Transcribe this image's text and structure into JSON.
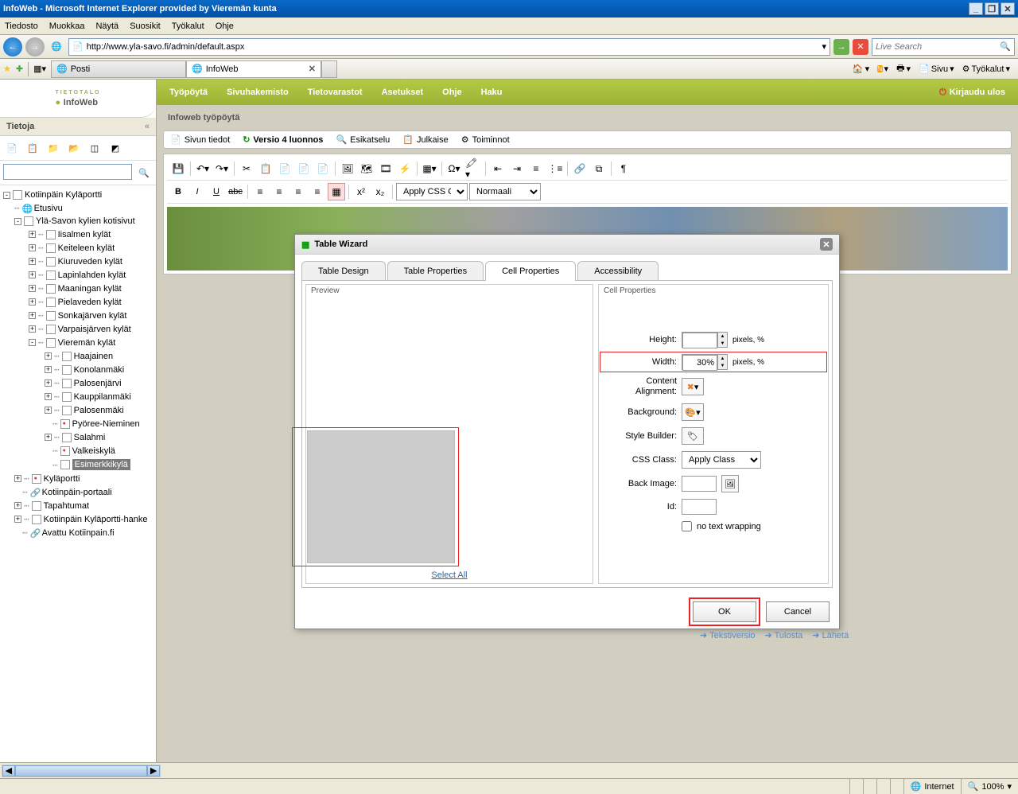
{
  "window": {
    "title": "InfoWeb - Microsoft Internet Explorer provided by Vieremän kunta"
  },
  "menu": {
    "tiedosto": "Tiedosto",
    "muokkaa": "Muokkaa",
    "nayta": "Näytä",
    "suosikit": "Suosikit",
    "tyokalut": "Työkalut",
    "ohje": "Ohje"
  },
  "address": {
    "url": "http://www.yla-savo.fi/admin/default.aspx",
    "search_placeholder": "Live Search"
  },
  "tabs": {
    "posti": "Posti",
    "infoweb": "InfoWeb"
  },
  "rightbar": {
    "sivu": "Sivu",
    "tyokalut": "Työkalut"
  },
  "logo": {
    "brand": "InfoWeb",
    "sub": "TIETOTALO"
  },
  "greenbar": {
    "tyopoyto": "Työpöytä",
    "sivuhakemisto": "Sivuhakemisto",
    "tietovarastot": "Tietovarastot",
    "asetukset": "Asetukset",
    "ohje": "Ohje",
    "haku": "Haku",
    "logout": "Kirjaudu ulos"
  },
  "sidebar": {
    "title": "Tietoja",
    "tree": {
      "root": "Kotiinpäin Kyläportti",
      "etusivu": "Etusivu",
      "ylasavo": "Ylä-Savon kylien kotisivut",
      "iisalmen": "Iisalmen kylät",
      "keiteleen": "Keiteleen kylät",
      "kiuruveden": "Kiuruveden kylät",
      "lapinlahden": "Lapinlahden kylät",
      "maaningan": "Maaningan kylät",
      "pielaveden": "Pielaveden kylät",
      "sonkajarven": "Sonkajärven kylät",
      "varpaisjarven": "Varpaisjärven kylät",
      "vieremaan": "Vieremän kylät",
      "haajainen": "Haajainen",
      "konolanmaki": "Konolanmäki",
      "palosenjarvi": "Palosenjärvi",
      "kauppilanmaki": "Kauppilanmäki",
      "palosenmaki": "Palosenmäki",
      "pyoree": "Pyöree-Nieminen",
      "salahmi": "Salahmi",
      "valkeiskyla": "Valkeiskylä",
      "esimerkki": "Esimerkkikylä",
      "kylaportti": "Kyläportti",
      "kotiinpain_port": "Kotiinpäin-portaali",
      "tapahtumat": "Tapahtumat",
      "hanke": "Kotiinpäin Kyläportti-hanke",
      "avattu": "Avattu Kotiinpain.fi"
    }
  },
  "breadcrumb": "Infoweb työpöytä",
  "actionbar": {
    "sivun_tiedot": "Sivun tiedot",
    "versio": "Versio 4 luonnos",
    "esikatselu": "Esikatselu",
    "julkaise": "Julkaise",
    "toiminnot": "Toiminnot"
  },
  "editor": {
    "css_sel": "Apply CSS Cl...",
    "format_sel": "Normaali"
  },
  "dialog": {
    "title": "Table Wizard",
    "tabs": {
      "design": "Table Design",
      "table_props": "Table Properties",
      "cell_props": "Cell Properties",
      "accessibility": "Accessibility"
    },
    "preview": "Preview",
    "select_all": "Select All",
    "cell_properties": "Cell Properties",
    "height": "Height:",
    "width": "Width:",
    "width_value": "30%",
    "content_alignment": "Content Alignment:",
    "background": "Background:",
    "style_builder": "Style Builder:",
    "css_class": "CSS Class:",
    "css_class_value": "Apply Class",
    "back_image": "Back Image:",
    "id": "Id:",
    "no_wrap": "no text wrapping",
    "units": "pixels, %",
    "ok": "OK",
    "cancel": "Cancel"
  },
  "footer_links": {
    "teksti": "Tekstiversio",
    "tulosta": "Tulosta",
    "laheta": "Lähetä"
  },
  "statusbar": {
    "internet": "Internet",
    "zoom": "100%"
  }
}
